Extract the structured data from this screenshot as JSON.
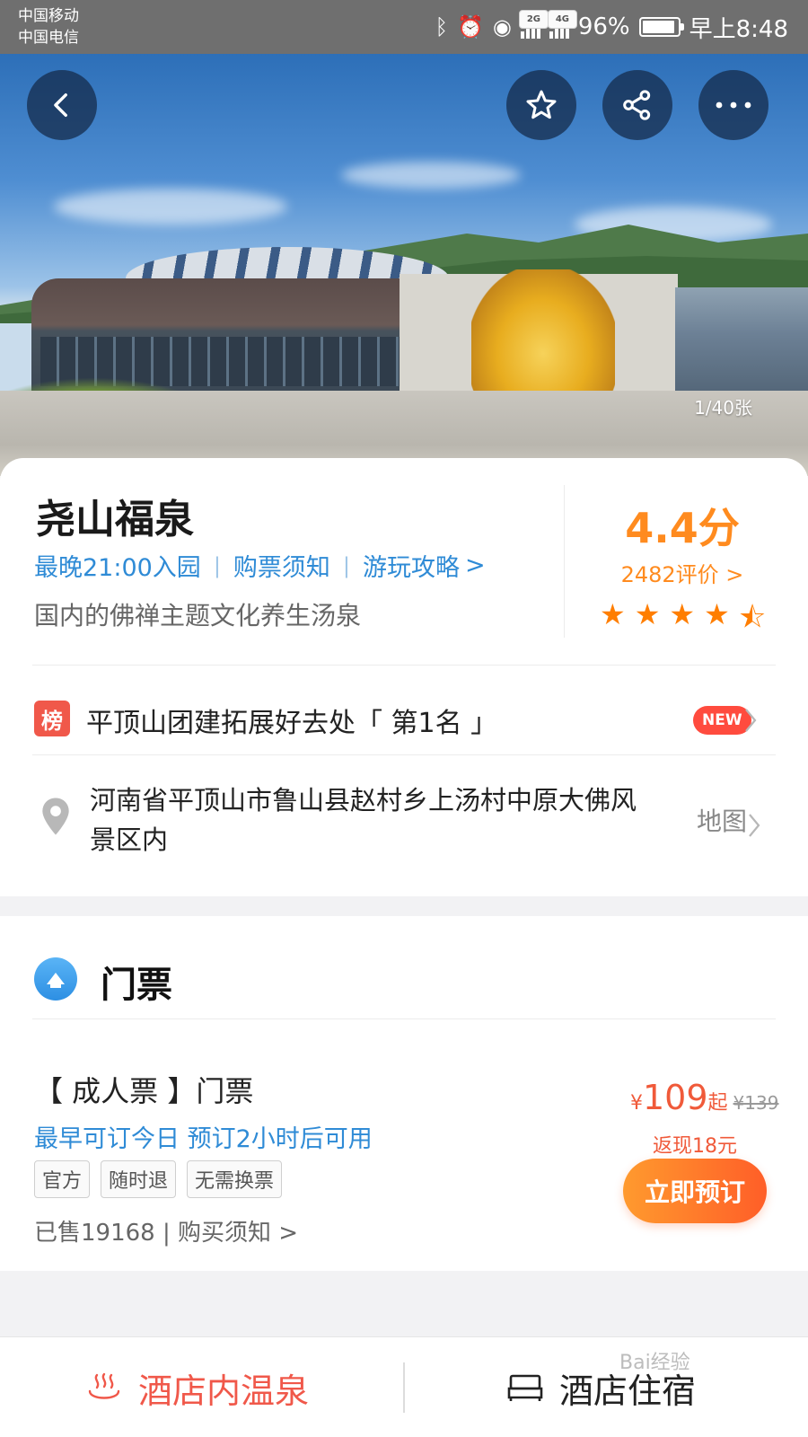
{
  "status_bar": {
    "carrier_1": "中国移动",
    "carrier_2": "中国电信",
    "net_1": "2G",
    "net_2": "4G",
    "battery": "96%",
    "time": "早上8:48"
  },
  "hero": {
    "photo_count": "1/40张",
    "buttons": [
      "back-icon",
      "star-icon",
      "share-icon",
      "more-icon"
    ]
  },
  "attraction": {
    "title": "尧山福泉",
    "link_1": "最晚21:00入园",
    "link_2": "购票须知",
    "link_3": "游玩攻略",
    "link_arrow": ">",
    "sep": "|",
    "subtitle": "国内的佛禅主题文化养生汤泉",
    "score": "4.4分",
    "reviews": "2482评价 >",
    "rating": 4.5
  },
  "ranking": {
    "badge": "榜",
    "text": "平顶山团建拓展好去处「 第1名 」",
    "new_label": "NEW"
  },
  "address": {
    "text": "河南省平顶山市鲁山县赵村乡上汤村中原大佛风景区内",
    "map_label": "地图"
  },
  "tickets": {
    "section_title": "门票",
    "name": "【 成人票 】门票",
    "note": "最早可订今日 预订2小时后可用",
    "tags": [
      "官方",
      "随时退",
      "无需换票"
    ],
    "sold": "已售19168 | 购买须知 >",
    "currency": "¥",
    "price": "109",
    "price_suffix": "起",
    "original_price": "¥139",
    "cashback": "返现18元",
    "book_label": "立即预订"
  },
  "bottom_bar": {
    "left_label": "酒店内温泉",
    "right_label": "酒店住宿",
    "watermark": "Bai经验"
  },
  "colors": {
    "accent_blue": "#2f8bd6",
    "score_orange": "#ff8b1f",
    "price_red": "#f05a3a",
    "badge_red": "#f0584a"
  }
}
